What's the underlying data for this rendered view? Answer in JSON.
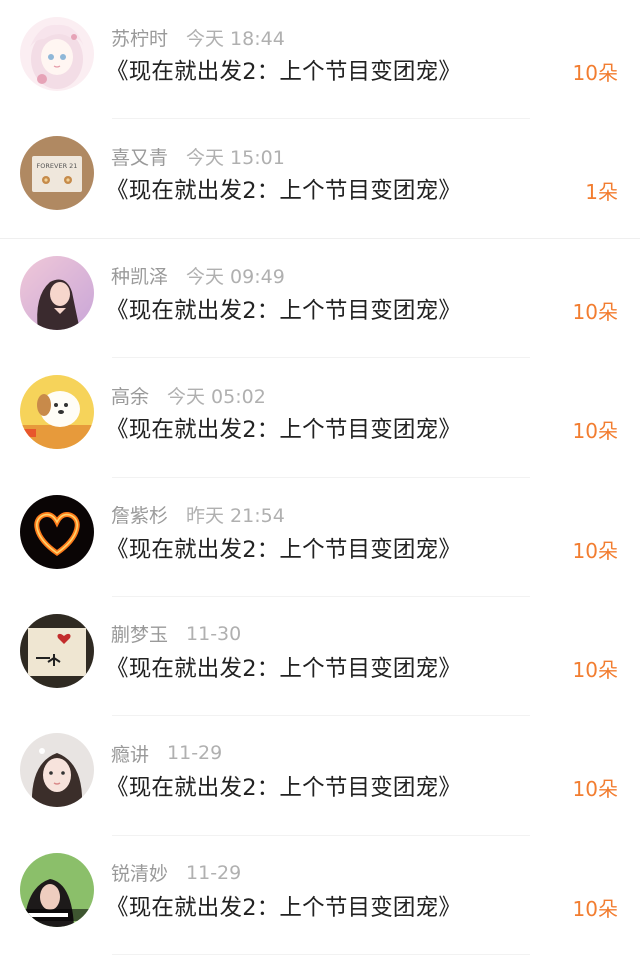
{
  "accent_color": "#f27d30",
  "rows": [
    {
      "name": "苏柠时",
      "time": "今天 18:44",
      "message": "《现在就出发2：上个节目变团宠》",
      "count": "10朵",
      "avatar_icon": "anime-girl-avatar"
    },
    {
      "name": "喜又青",
      "time": "今天 15:01",
      "message": "《现在就出发2：上个节目变团宠》",
      "count": "1朵",
      "avatar_icon": "forever21-box-avatar"
    },
    {
      "name": "种凯泽",
      "time": "今天 09:49",
      "message": "《现在就出发2：上个节目变团宠》",
      "count": "10朵",
      "avatar_icon": "girl-photo-avatar"
    },
    {
      "name": "高余",
      "time": "今天 05:02",
      "message": "《现在就出发2：上个节目变团宠》",
      "count": "10朵",
      "avatar_icon": "cartoon-dog-avatar"
    },
    {
      "name": "詹紫杉",
      "time": "昨天 21:54",
      "message": "《现在就出发2：上个节目变团宠》",
      "count": "10朵",
      "avatar_icon": "fire-heart-avatar"
    },
    {
      "name": "蒯梦玉",
      "time": "11-30",
      "message": "《现在就出发2：上个节目变团宠》",
      "count": "10朵",
      "avatar_icon": "handwriting-heart-avatar"
    },
    {
      "name": "瘾讲",
      "time": "11-29",
      "message": "《现在就出发2：上个节目变团宠》",
      "count": "10朵",
      "avatar_icon": "girl-selfie-avatar"
    },
    {
      "name": "锐清妙",
      "time": "11-29",
      "message": "《现在就出发2：上个节目变团宠》",
      "count": "10朵",
      "avatar_icon": "girl-caption-avatar"
    }
  ]
}
